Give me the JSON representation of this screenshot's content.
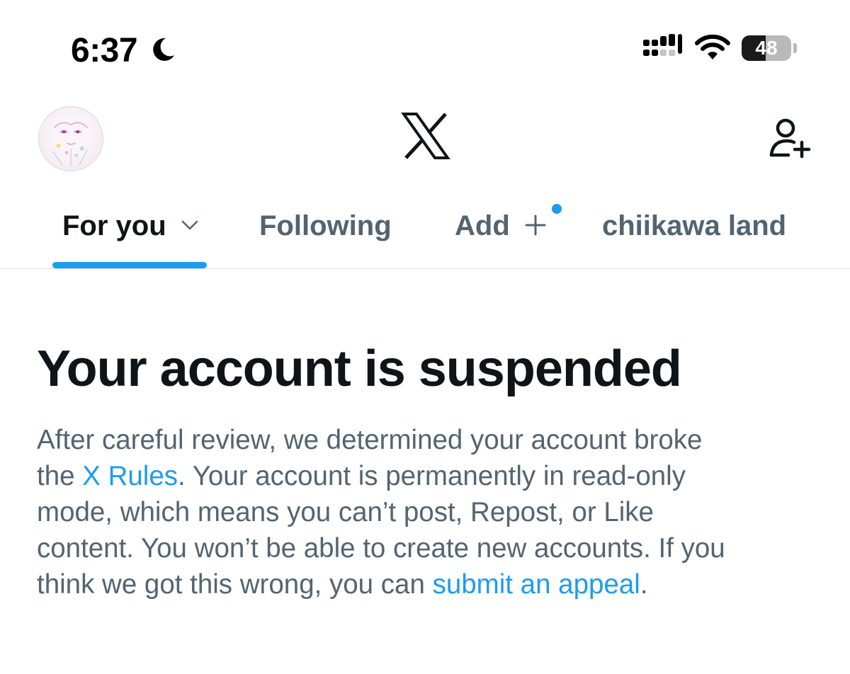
{
  "status_bar": {
    "time": "6:37",
    "battery_percent": "48",
    "battery_level": 0.48
  },
  "header": {
    "logo_icon": "x-logo-icon",
    "avatar_icon": "profile-avatar",
    "add_account_icon": "add-person-icon"
  },
  "tabs": [
    {
      "label": "For you",
      "active": true,
      "icon": "chevron-down-icon"
    },
    {
      "label": "Following",
      "active": false
    },
    {
      "label": "Add",
      "active": false,
      "icon": "plus-icon",
      "has_notification_dot": true
    },
    {
      "label": "chiikawa land",
      "active": false
    }
  ],
  "notice": {
    "title": "Your account is suspended",
    "line1": "After careful review, we determined your account broke",
    "line2_pre": "the ",
    "rules_link": "X Rules",
    "line2_post": ". Your account is permanently in read-only",
    "line3": "mode, which means you can’t post, Repost, or Like",
    "line4": "content. You won’t be able to create new accounts. If you",
    "line5_pre": "think we got this wrong, you can ",
    "appeal_link": "submit an appeal",
    "line5_post": "."
  },
  "colors": {
    "accent": "#1d9bf0",
    "text_primary": "#0f1419",
    "text_secondary": "#536471"
  }
}
